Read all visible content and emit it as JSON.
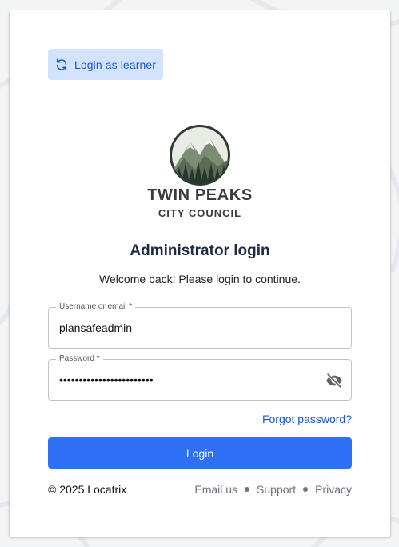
{
  "learner_button": {
    "label": "Login as learner",
    "icon": "refresh-icon"
  },
  "logo": {
    "title": "TWIN PEAKS",
    "subtitle": "CITY COUNCIL"
  },
  "heading": "Administrator login",
  "subtext": "Welcome back! Please login to continue.",
  "username": {
    "label": "Username or email *",
    "value": "plansafeadmin"
  },
  "password": {
    "label": "Password *",
    "value": "••••••••••••••••••••••••",
    "toggle_icon": "eye-slash-icon"
  },
  "forgot_password": "Forgot password?",
  "login_button": "Login",
  "footer": {
    "copyright": "© 2025 Locatrix",
    "links": [
      "Email us",
      "Support",
      "Privacy"
    ]
  },
  "colors": {
    "primary": "#2f6ff6",
    "learner_bg": "#d3e3fd",
    "link": "#1a56c4",
    "heading": "#1b2a45"
  }
}
